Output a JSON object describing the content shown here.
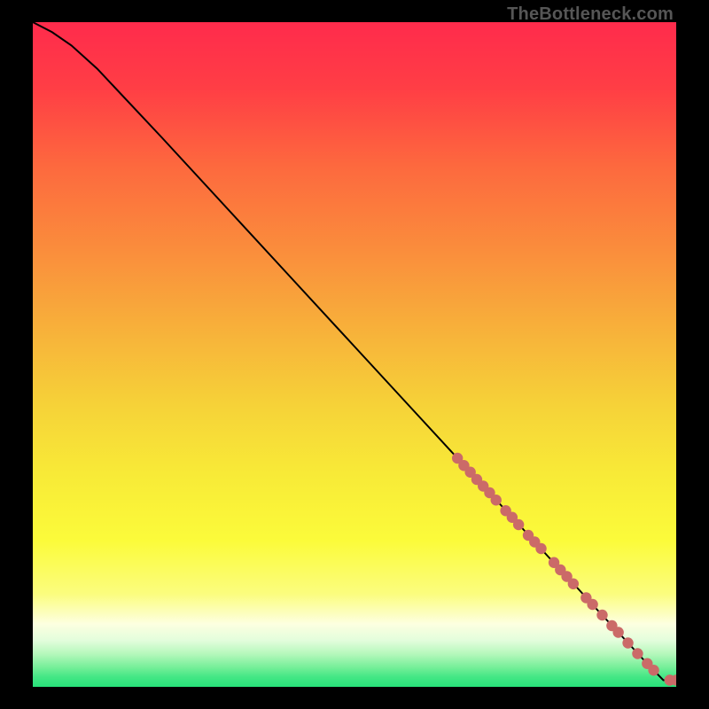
{
  "chart_data": {
    "type": "line",
    "watermark": "TheBottleneck.com",
    "title": "",
    "xlabel": "",
    "ylabel": "",
    "x_range": [
      0,
      100
    ],
    "y_range": [
      0,
      100
    ],
    "curve": {
      "x": [
        0,
        3,
        6,
        10,
        20,
        30,
        40,
        50,
        60,
        66,
        70,
        75,
        80,
        85,
        88,
        91,
        93,
        95,
        96,
        97,
        98,
        100
      ],
      "y": [
        100,
        98.5,
        96.5,
        93,
        82.7,
        72.2,
        61.7,
        51.2,
        40.7,
        34.4,
        30.2,
        25,
        19.7,
        14.5,
        11.3,
        8.2,
        6.1,
        4,
        3,
        2,
        1,
        1
      ]
    },
    "scatter": {
      "color": "#cb6a68",
      "points": [
        {
          "x": 66,
          "y": 34.4
        },
        {
          "x": 67,
          "y": 33.3
        },
        {
          "x": 68,
          "y": 32.3
        },
        {
          "x": 69,
          "y": 31.2
        },
        {
          "x": 70,
          "y": 30.2
        },
        {
          "x": 71,
          "y": 29.2
        },
        {
          "x": 72,
          "y": 28.1
        },
        {
          "x": 73.5,
          "y": 26.5
        },
        {
          "x": 74.5,
          "y": 25.5
        },
        {
          "x": 75.5,
          "y": 24.4
        },
        {
          "x": 77,
          "y": 22.8
        },
        {
          "x": 78,
          "y": 21.8
        },
        {
          "x": 79,
          "y": 20.8
        },
        {
          "x": 81,
          "y": 18.7
        },
        {
          "x": 82,
          "y": 17.6
        },
        {
          "x": 83,
          "y": 16.6
        },
        {
          "x": 84,
          "y": 15.5
        },
        {
          "x": 86,
          "y": 13.4
        },
        {
          "x": 87,
          "y": 12.4
        },
        {
          "x": 88.5,
          "y": 10.8
        },
        {
          "x": 90,
          "y": 9.2
        },
        {
          "x": 91,
          "y": 8.2
        },
        {
          "x": 92.5,
          "y": 6.6
        },
        {
          "x": 94,
          "y": 5.0
        },
        {
          "x": 95.5,
          "y": 3.5
        },
        {
          "x": 96.5,
          "y": 2.5
        },
        {
          "x": 99,
          "y": 1.0
        },
        {
          "x": 100,
          "y": 1.0
        }
      ]
    },
    "gradient_stops": [
      {
        "offset": 0.0,
        "color": "#ff2b4c"
      },
      {
        "offset": 0.1,
        "color": "#ff3e45"
      },
      {
        "offset": 0.22,
        "color": "#fd6a3e"
      },
      {
        "offset": 0.35,
        "color": "#fa8f3c"
      },
      {
        "offset": 0.48,
        "color": "#f7b63a"
      },
      {
        "offset": 0.58,
        "color": "#f6d338"
      },
      {
        "offset": 0.68,
        "color": "#f8ea37"
      },
      {
        "offset": 0.78,
        "color": "#fbfb3a"
      },
      {
        "offset": 0.86,
        "color": "#fbfd7e"
      },
      {
        "offset": 0.905,
        "color": "#fdffe0"
      },
      {
        "offset": 0.93,
        "color": "#e3fddc"
      },
      {
        "offset": 0.95,
        "color": "#b6f8bc"
      },
      {
        "offset": 0.97,
        "color": "#78ef9a"
      },
      {
        "offset": 0.985,
        "color": "#44e785"
      },
      {
        "offset": 1.0,
        "color": "#27e17a"
      }
    ]
  }
}
